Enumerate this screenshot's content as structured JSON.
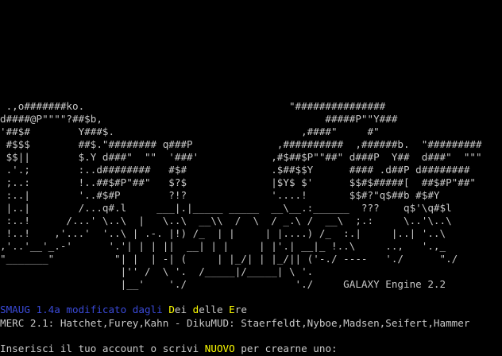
{
  "ascii_art": [
    " .,o#######ko.                                  \"###############",
    "d####@P\"\"\"\"?##$b,                                     #####P\"\"Y###",
    "'##$#        Y###$.                               ,####\"     #\"",
    " #$$$        ##$.\"######## q###P              ,##########  ,######b.  \"#########",
    " $$||        $.Y d###\"  \"\"  '###'            ,#$##$P\"\"##\" d###P  Y##  d###\"  \"\"\"",
    " .'.;        :..d########   #$#              .$##$$Y      #### .d##P d########",
    " ;..:        !..##$#P\"##\"   $?$              |$Y$ $'      $$#$#####[  ##$#P\"##\"",
    " :..|        '..#$#P        ?!?              '....!       $$#?\"q$##b #$#Y",
    " |..|        /...q#.l     ___|.|_____ _____  __\\__.:______  ???    q$'\\q#$l",
    " :..!      /...' \\..\\  |   \\..\\  __\\\\  /  \\  / _.\\ /  __\\  ;.:     \\..'\\..\\",
    " !..!    ,'...'  '..\\ | .-. |!) /_  | |     | |....) /_  :.|     |..| '..\\",
    ",'..'__'_.-'      '.'| | | ||  __| | |     | |'.| __|_ !..\\     ..,   '.,_",
    "\"_______\"          \"| |  | -| (     | |_/| | |_/|| ('-./ ----   './      \"./",
    "                    |'' /  \\ '.  /_____|/_____| \\ '.",
    "                    |__'    './                  './     GALAXY Engine 2.2"
  ],
  "smaug": {
    "part1": "SMAUG 1.4a modificato dagli ",
    "dei_D": "D",
    "dei_rest": "ei ",
    "delle_d": "d",
    "delle_rest": "elle ",
    "ere_E": "E",
    "ere_rest": "re"
  },
  "merc_line": "MERC 2.1: Hatchet,Furey,Kahn - DikuMUD: Staerfeldt,Nyboe,Madsen,Seifert,Hammer",
  "prompt": {
    "before": "Inserisci il tuo account o scrivi ",
    "keyword": "NUOVO",
    "after": " per crearne uno:"
  },
  "colors": {
    "background": "#000000",
    "text": "#c8c8c8",
    "blue": "#3a4ad8",
    "yellow": "#ffff00"
  }
}
